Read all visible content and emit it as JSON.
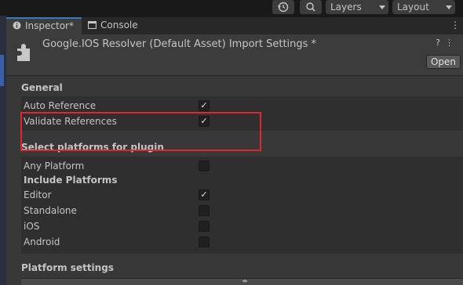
{
  "toolbar": {
    "history_icon": "history-icon",
    "search_icon": "search-icon",
    "layers_label": "Layers",
    "layout_label": "Layout"
  },
  "tabs": [
    {
      "label": "Inspector*",
      "icon": "info-icon",
      "active": true
    },
    {
      "label": "Console",
      "icon": "console-icon",
      "active": false
    }
  ],
  "header": {
    "title": "Google.IOS Resolver (Default Asset) Import Settings *",
    "open_label": "Open"
  },
  "general": {
    "title": "General",
    "rows": [
      {
        "label": "Auto Reference",
        "checked": true
      },
      {
        "label": "Validate References",
        "checked": true
      }
    ]
  },
  "platforms": {
    "title": "Select platforms for plugin",
    "any_platform": {
      "label": "Any Platform",
      "checked": false
    },
    "include_title": "Include Platforms",
    "rows": [
      {
        "label": "Editor",
        "checked": true
      },
      {
        "label": "Standalone",
        "checked": false
      },
      {
        "label": "iOS",
        "checked": false
      },
      {
        "label": "Android",
        "checked": false
      }
    ]
  },
  "platform_settings": {
    "title": "Platform settings"
  },
  "colors": {
    "highlight": "#e0262f",
    "active_tab_accent": "#3a79bb"
  }
}
